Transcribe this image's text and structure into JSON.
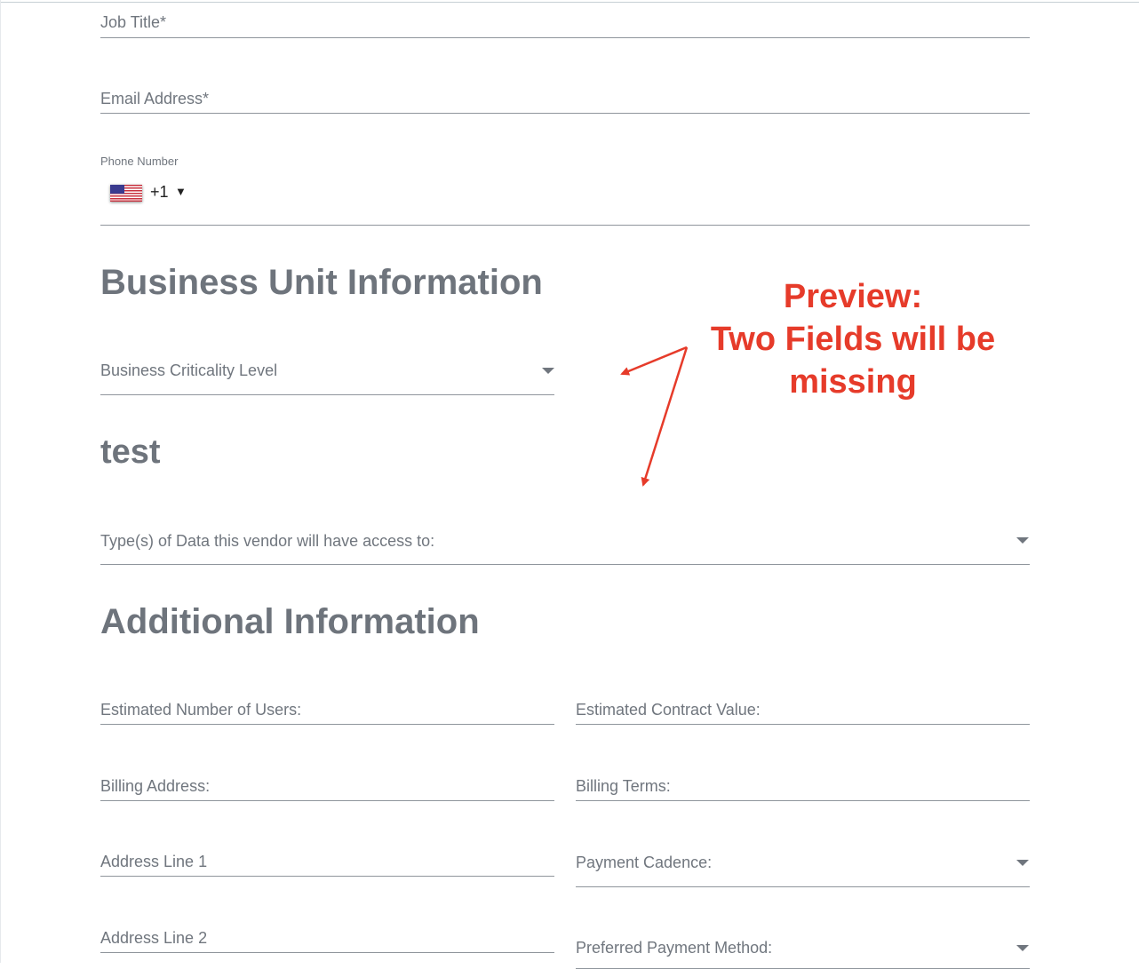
{
  "contact": {
    "job_title_label": "Job Title*",
    "email_label": "Email Address*",
    "phone_label": "Phone Number",
    "phone_code": "+1",
    "phone_dropdown_glyph": "▼",
    "flag_icon": "us-flag-icon"
  },
  "business_unit": {
    "heading": "Business Unit Information",
    "criticality_label": "Business Criticality Level"
  },
  "test_section": {
    "heading": "test",
    "data_types_label": "Type(s) of Data this vendor will have access to:"
  },
  "additional": {
    "heading": "Additional Information",
    "estimated_users_label": "Estimated Number of Users:",
    "estimated_value_label": "Estimated Contract Value:",
    "billing_address_label": "Billing Address:",
    "billing_terms_label": "Billing Terms:",
    "address_line1_label": "Address Line 1",
    "payment_cadence_label": "Payment Cadence:",
    "address_line2_label": "Address Line 2",
    "payment_method_label": "Preferred Payment Method:"
  },
  "annotation": {
    "line1": "Preview:",
    "line2": "Two Fields will be",
    "line3": "missing",
    "color": "#e63b2a"
  }
}
